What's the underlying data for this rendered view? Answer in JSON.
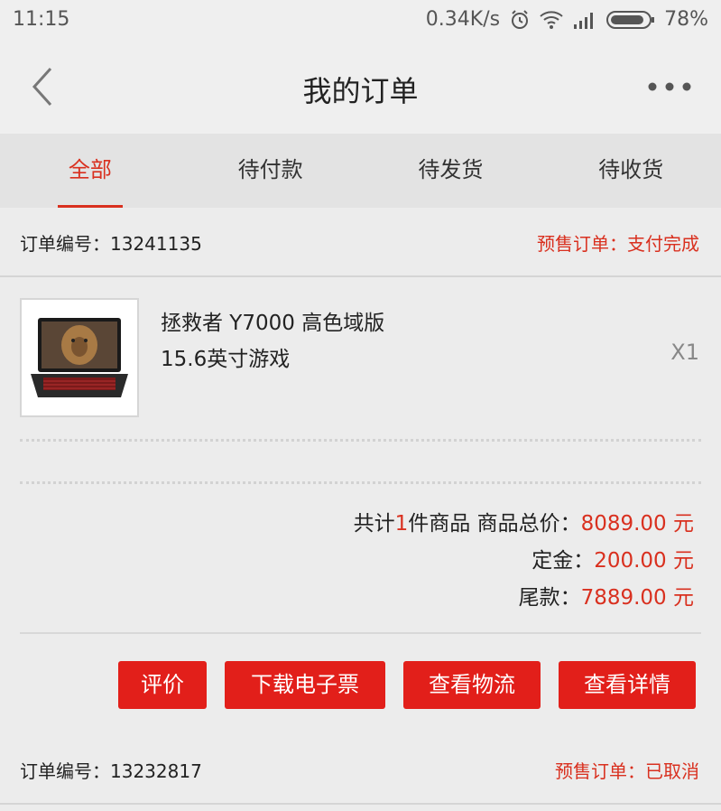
{
  "status_bar": {
    "time": "11:15",
    "net_speed": "0.34K/s",
    "battery": "78%"
  },
  "header": {
    "title": "我的订单"
  },
  "tabs": [
    {
      "label": "全部",
      "active": true
    },
    {
      "label": "待付款",
      "active": false
    },
    {
      "label": "待发货",
      "active": false
    },
    {
      "label": "待收货",
      "active": false
    }
  ],
  "orders": [
    {
      "number_label": "订单编号：13241135",
      "status": "预售订单：支付完成",
      "product": {
        "name": "拯救者 Y7000 高色域版 15.6英寸游戏",
        "quantity": "X1"
      },
      "summary": {
        "count_prefix": "共计",
        "count": "1",
        "count_suffix": "件商品 商品总价：",
        "total": "8089.00 元",
        "deposit_label": "定金：",
        "deposit": "200.00 元",
        "balance_label": "尾款：",
        "balance": "7889.00 元"
      },
      "actions": [
        "评价",
        "下载电子票",
        "查看物流",
        "查看详情"
      ]
    },
    {
      "number_label": "订单编号：13232817",
      "status": "预售订单：已取消"
    }
  ],
  "colors": {
    "accent": "#d9301f",
    "button": "#e21f1a",
    "background": "#ececec"
  }
}
